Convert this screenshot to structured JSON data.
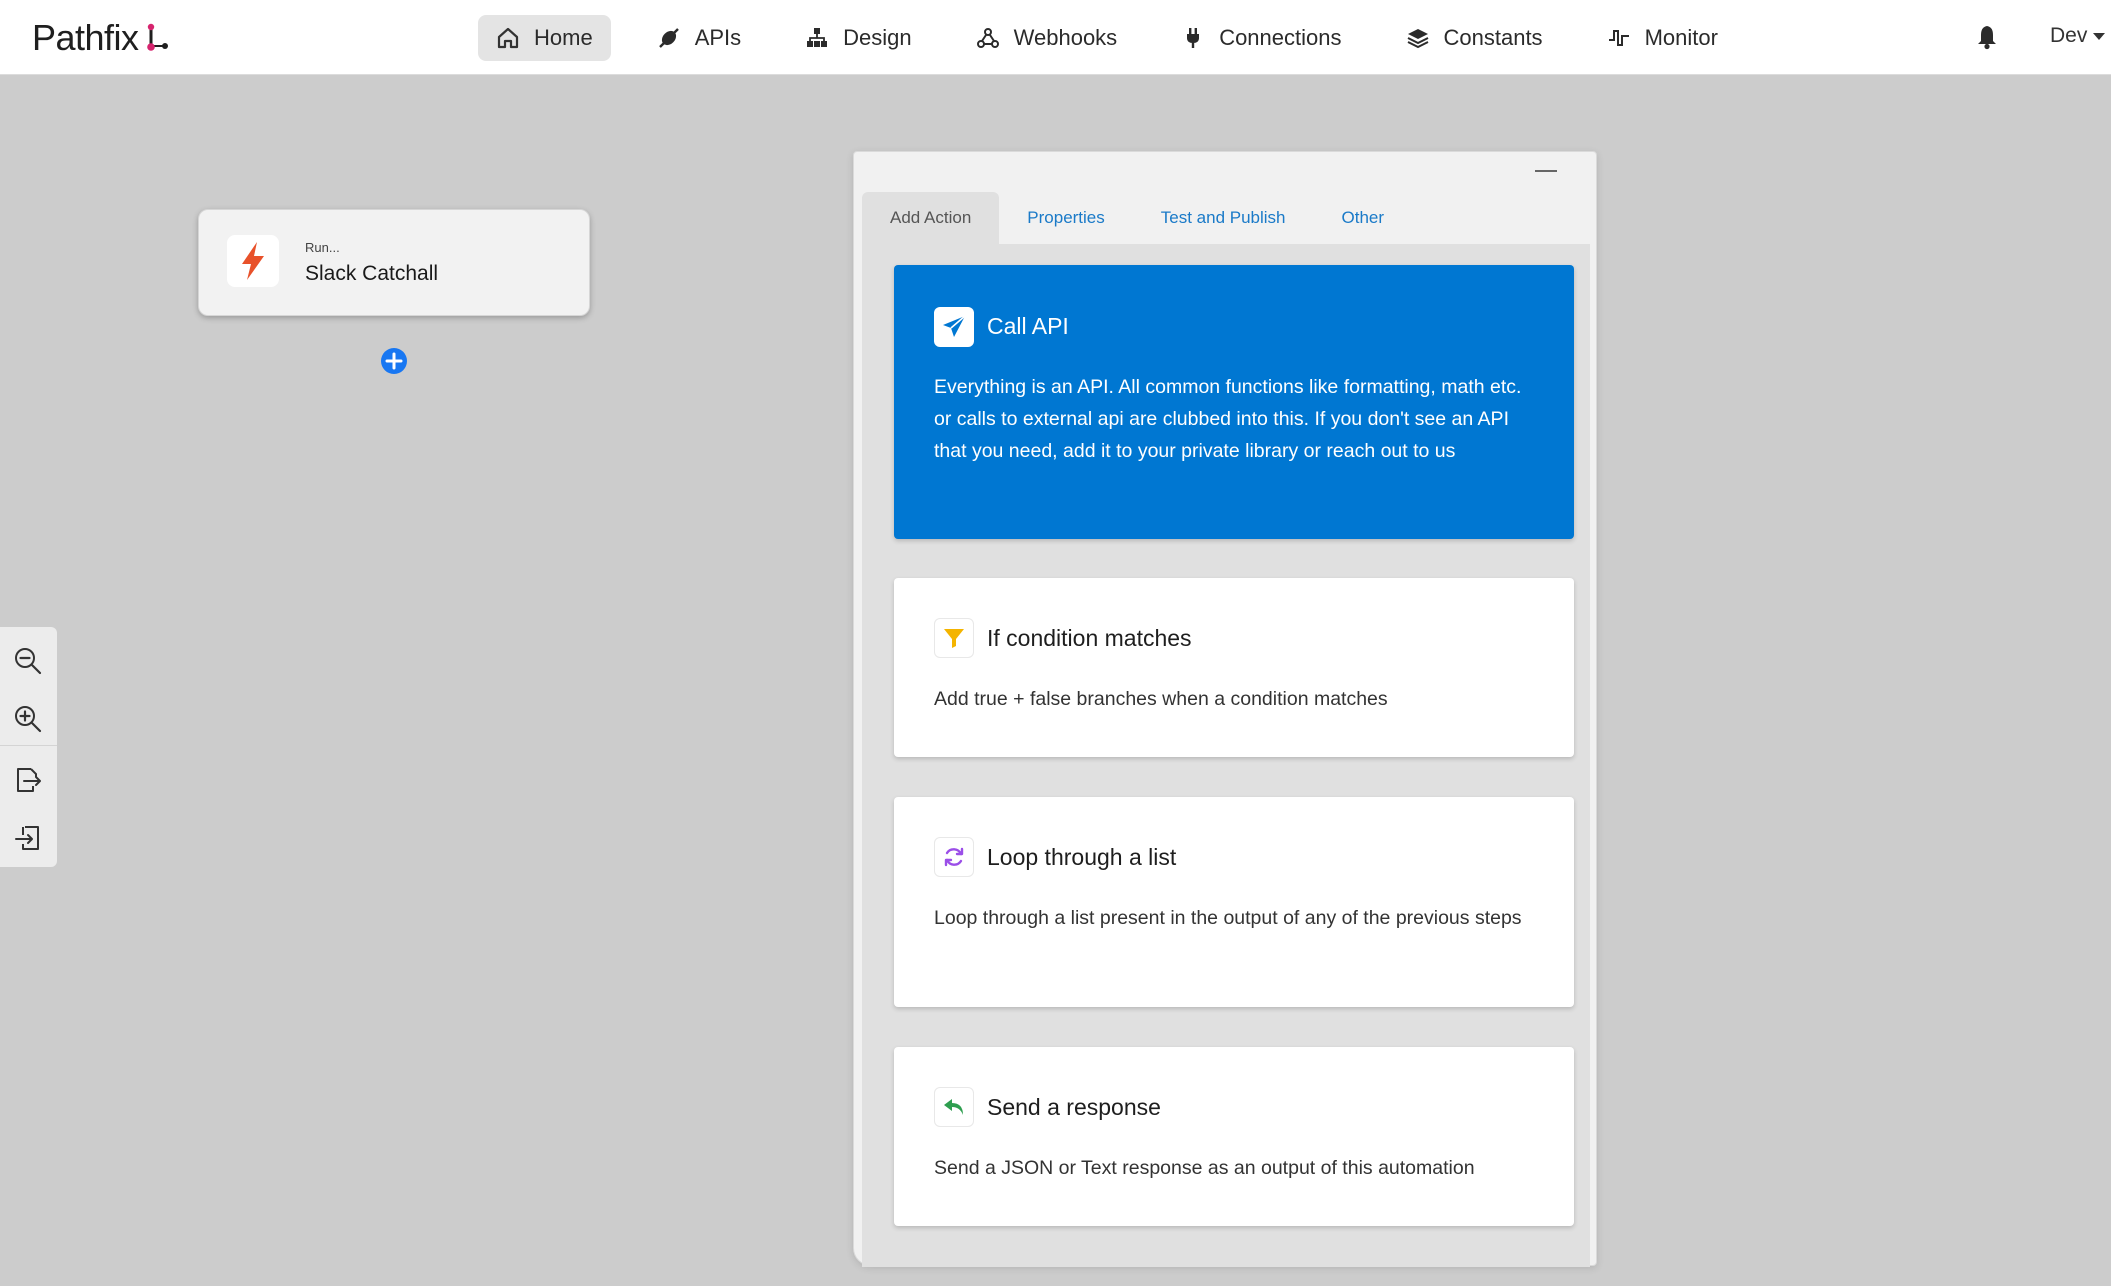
{
  "app": {
    "logo_text": "Pathfix"
  },
  "nav": {
    "items": [
      {
        "label": "Home",
        "icon": "home-icon",
        "active": true
      },
      {
        "label": "APIs",
        "icon": "plug-icon",
        "active": false
      },
      {
        "label": "Design",
        "icon": "sitemap-icon",
        "active": false
      },
      {
        "label": "Webhooks",
        "icon": "webhook-icon",
        "active": false
      },
      {
        "label": "Connections",
        "icon": "power-plug-icon",
        "active": false
      },
      {
        "label": "Constants",
        "icon": "layers-icon",
        "active": false
      },
      {
        "label": "Monitor",
        "icon": "pulse-icon",
        "active": false
      }
    ],
    "env_label": "Dev"
  },
  "canvas": {
    "node": {
      "subtitle": "Run...",
      "title": "Slack Catchall",
      "icon": "lightning-bolt-icon"
    }
  },
  "toolbar": {
    "tools": [
      "zoom-out-icon",
      "zoom-in-icon",
      "export-icon",
      "import-icon"
    ]
  },
  "panel": {
    "tabs": [
      {
        "label": "Add Action",
        "active": true
      },
      {
        "label": "Properties",
        "active": false
      },
      {
        "label": "Test and Publish",
        "active": false
      },
      {
        "label": "Other",
        "active": false
      }
    ],
    "cards": [
      {
        "title": "Call API",
        "icon": "paper-plane-icon",
        "description": "Everything is an API. All common functions like formatting, math etc. or calls to external api are clubbed into this. If you don't see an API that you need, add it to your private library or reach out to us"
      },
      {
        "title": "If condition matches",
        "icon": "filter-icon",
        "description": "Add true + false branches when a condition matches"
      },
      {
        "title": "Loop through a list",
        "icon": "refresh-icon",
        "description": "Loop through a list present in the output of any of the previous steps"
      },
      {
        "title": "Send a response",
        "icon": "reply-icon",
        "description": "Send a JSON or Text response as an output of this automation"
      }
    ]
  },
  "colors": {
    "accent": "#0077d2",
    "tab_link": "#1a7ac8",
    "bolt": "#e8512a",
    "filter": "#f4b400",
    "loop": "#9b4ee8",
    "reply": "#2e9e4f",
    "add_button": "#1877f2"
  }
}
